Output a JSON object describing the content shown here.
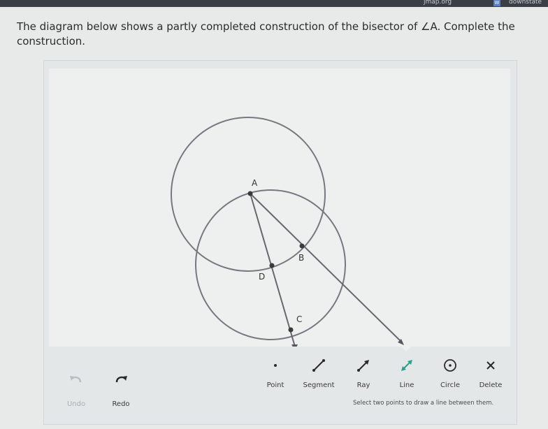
{
  "topbar": {
    "site_text": "jmap.org",
    "w_badge": "W",
    "user_text": "downstate"
  },
  "question": {
    "text": "The diagram below shows a partly completed construction of the bisector of ∠A. Complete the construction."
  },
  "diagram": {
    "points": {
      "A": "A",
      "B": "B",
      "C": "C",
      "D": "D"
    }
  },
  "toolbar": {
    "undo_label": "Undo",
    "redo_label": "Redo",
    "point_label": "Point",
    "segment_label": "Segment",
    "ray_label": "Ray",
    "line_label": "Line",
    "circle_label": "Circle",
    "delete_label": "Delete",
    "active_tool": "Line"
  },
  "hint": {
    "text": "Select two points to draw a line between them."
  },
  "colors": {
    "accent": "#2ba08a",
    "circle_stroke": "#7a7680",
    "line_stroke": "#6a6670"
  }
}
